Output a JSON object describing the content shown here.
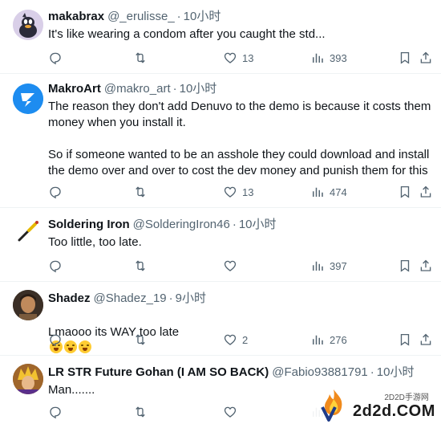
{
  "tweets": [
    {
      "name": "makabrax",
      "handle": "@_erulisse_",
      "sep": "·",
      "time": "10小时",
      "text": "It's like wearing a condom after you caught the std...",
      "likes": "13",
      "views": "393",
      "replies": "",
      "retweets": ""
    },
    {
      "name": "MakroArt",
      "handle": "@makro_art",
      "sep": "·",
      "time": "10小时",
      "text": "The reason they don't add Denuvo to the demo is because it costs them money when you install it.\n\nSo if someone wanted to be an asshole they could download and install the demo over and over to cost the dev money and punish them for this",
      "likes": "13",
      "views": "474",
      "replies": "",
      "retweets": ""
    },
    {
      "name": "Soldering Iron",
      "handle": "@SolderingIron46",
      "sep": "·",
      "time": "10小时",
      "text": "Too little, too late.",
      "likes": "",
      "views": "397",
      "replies": "",
      "retweets": ""
    },
    {
      "name": "Shadez",
      "handle": "@Shadez_19",
      "sep": "·",
      "time": "9小时",
      "text": "Lmaooo its WAY too late",
      "likes": "2",
      "views": "276",
      "replies": "",
      "retweets": ""
    },
    {
      "name": "LR STR Future Gohan (I AM SO BACK)",
      "handle": "@Fabio93881791",
      "sep": "·",
      "time": "10小时",
      "text": "Man.......",
      "likes": "",
      "views": "",
      "replies": "",
      "retweets": ""
    }
  ],
  "watermark": {
    "small": "2D2D手游网",
    "big": "2d2d.COM"
  },
  "icons": {
    "reply": "reply-icon",
    "retweet": "retweet-icon",
    "like": "heart-icon",
    "views": "views-icon",
    "bookmark": "bookmark-icon",
    "share": "share-icon"
  },
  "colors": {
    "text": "#0f1419",
    "secondary": "#536471",
    "verified_blue": "#1d9bf0",
    "divider": "#eff3f4"
  }
}
